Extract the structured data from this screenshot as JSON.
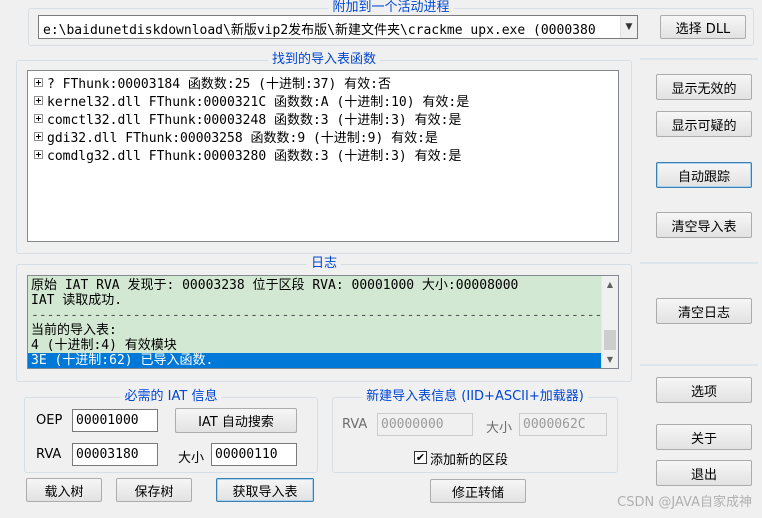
{
  "attach": {
    "title": "附加到一个活动进程",
    "process_value": "e:\\baidunetdiskdownload\\新版vip2发布版\\新建文件夹\\crackme upx.exe (0000380",
    "select_dll_label": "选择 DLL"
  },
  "imports": {
    "title": "找到的导入表函数",
    "rows": [
      "? FThunk:00003184 函数数:25 (十进制:37) 有效:否",
      "kernel32.dll FThunk:0000321C 函数数:A (十进制:10) 有效:是",
      "comctl32.dll FThunk:00003248 函数数:3 (十进制:3) 有效:是",
      "gdi32.dll FThunk:00003258 函数数:9 (十进制:9) 有效:是",
      "comdlg32.dll FThunk:00003280 函数数:3 (十进制:3) 有效:是"
    ]
  },
  "right_buttons": {
    "show_invalid": "显示无效的",
    "show_suspect": "显示可疑的",
    "auto_trace": "自动跟踪",
    "clear_imports": "清空导入表",
    "clear_log": "清空日志",
    "options": "选项",
    "about": "关于",
    "exit": "退出"
  },
  "log": {
    "title": "日志",
    "lines": [
      "原始 IAT RVA 发现于: 00003238 位于区段 RVA: 00001000 大小:00008000",
      "IAT 读取成功.",
      "------------------------------------------------------------------------------------",
      "当前的导入表:",
      "4 (十进制:4) 有效模块",
      "3E (十进制:62) 已导入函数."
    ]
  },
  "iat": {
    "title": "必需的 IAT 信息",
    "oep_label": "OEP",
    "oep_value": "00001000",
    "autosearch_label": "IAT 自动搜索",
    "rva_label": "RVA",
    "rva_value": "00003180",
    "size_label": "大小",
    "size_value": "00000110"
  },
  "new_import": {
    "title": "新建导入表信息 (IID+ASCII+加载器)",
    "rva_label": "RVA",
    "rva_value": "00000000",
    "size_label": "大小",
    "size_value": "0000062C",
    "add_section_label": "添加新的区段",
    "add_section_checked": true
  },
  "bottom_buttons": {
    "load_tree": "载入树",
    "save_tree": "保存树",
    "get_imports": "获取导入表",
    "fix_dump": "修正转储"
  },
  "watermark": "CSDN @JAVA自家成神"
}
